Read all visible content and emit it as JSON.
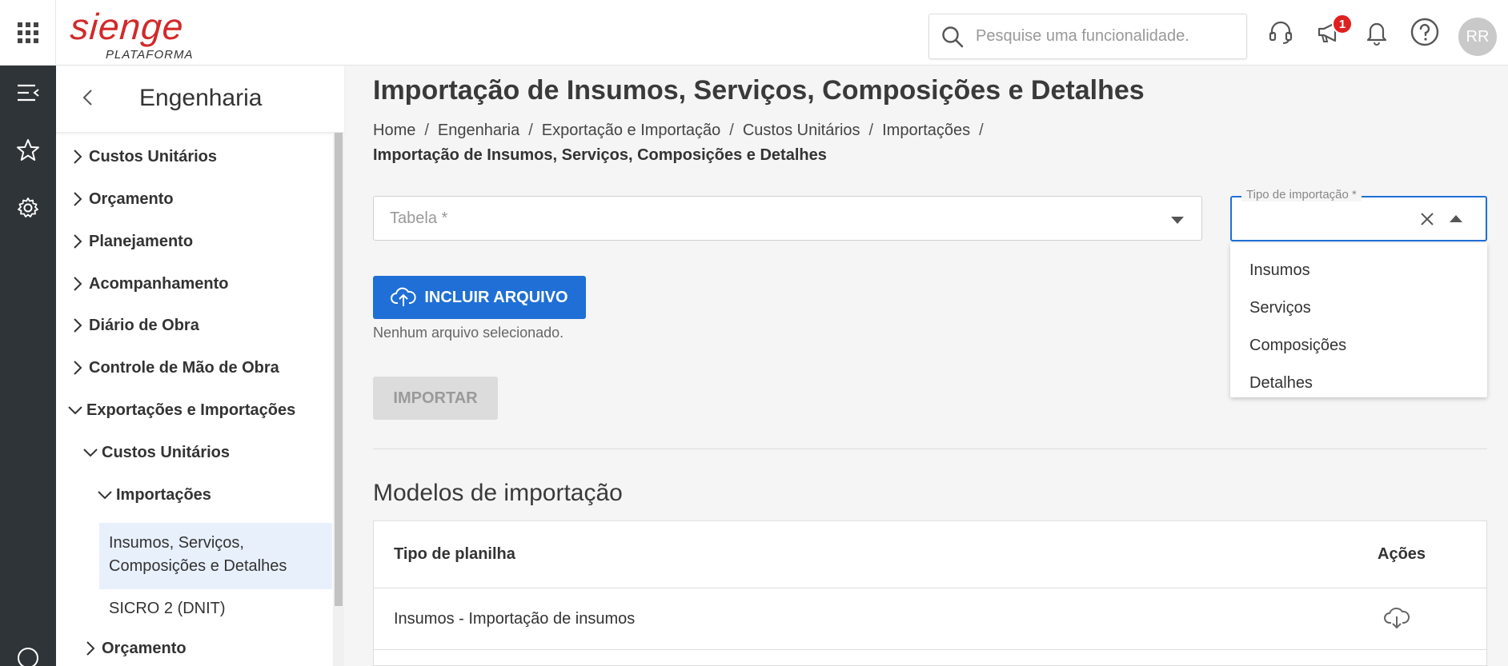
{
  "header": {
    "logo_main": "sienge",
    "logo_sub": "PLATAFORMA",
    "search_placeholder": "Pesquise uma funcionalidade.",
    "notifications_badge": "1",
    "avatar_initials": "RR",
    "icons": [
      "apps-grid-icon",
      "search-icon",
      "headset-icon",
      "megaphone-icon",
      "bell-icon",
      "help-icon"
    ]
  },
  "rail": {
    "icons": [
      "menu-collapse-icon",
      "star-icon",
      "gear-icon",
      "phone-icon"
    ]
  },
  "sidebar": {
    "title": "Engenharia",
    "items": [
      {
        "label": "Custos Unitários",
        "expanded": false
      },
      {
        "label": "Orçamento",
        "expanded": false
      },
      {
        "label": "Planejamento",
        "expanded": false
      },
      {
        "label": "Acompanhamento",
        "expanded": false
      },
      {
        "label": "Diário de Obra",
        "expanded": false
      },
      {
        "label": "Controle de Mão de Obra",
        "expanded": false
      },
      {
        "label": "Exportações e Importações",
        "expanded": true
      }
    ],
    "sub1": {
      "label": "Custos Unitários",
      "expanded": true
    },
    "sub2": {
      "label": "Importações",
      "expanded": true
    },
    "leaf_active_line1": "Insumos, Serviços,",
    "leaf_active_line2": "Composições e Detalhes",
    "leaf_sicro": "SICRO 2 (DNIT)",
    "sub_orcamento": {
      "label": "Orçamento",
      "expanded": false
    }
  },
  "main": {
    "title": "Importação de Insumos, Serviços, Composições e Detalhes",
    "breadcrumb": [
      "Home",
      "Engenharia",
      "Exportação e Importação",
      "Custos Unitários",
      "Importações"
    ],
    "breadcrumb_current": "Importação de Insumos, Serviços, Composições e Detalhes",
    "tabela_placeholder": "Tabela *",
    "tipo_label": "Tipo de importação *",
    "tipo_options": [
      "Insumos",
      "Serviços",
      "Composições",
      "Detalhes"
    ],
    "btn_incluir": "INCLUIR ARQUIVO",
    "file_status": "Nenhum arquivo selecionado.",
    "btn_importar": "IMPORTAR",
    "section_title": "Modelos de importação",
    "table": {
      "headers": [
        "Tipo de planilha",
        "Ações"
      ],
      "rows": [
        {
          "tipo": "Insumos - Importação de insumos",
          "acao_icon": "cloud-download-icon"
        }
      ]
    }
  },
  "colors": {
    "accent": "#1f6fd6",
    "brand_red": "#d12a2a",
    "rail_bg": "#2f3438",
    "active_bg": "#e8f0fb",
    "badge": "#e02020"
  }
}
